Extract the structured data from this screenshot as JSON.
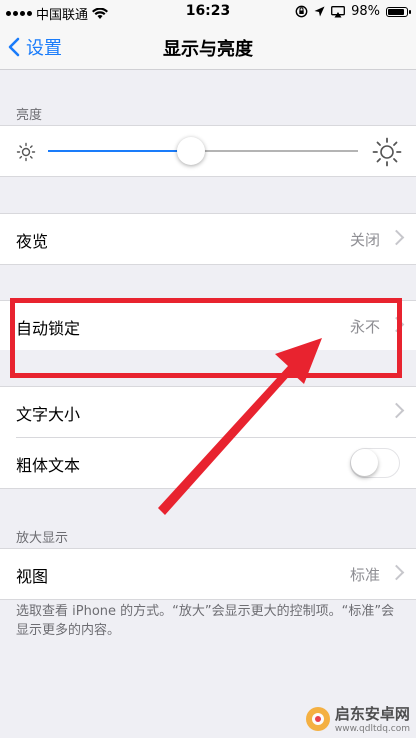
{
  "status_bar": {
    "carrier": "中国联通",
    "time": "16:23",
    "battery": "98%"
  },
  "nav": {
    "back_label": "设置",
    "title": "显示与亮度"
  },
  "brightness": {
    "header": "亮度",
    "level": 0.46
  },
  "night_shift": {
    "label": "夜览",
    "value": "关闭"
  },
  "auto_lock": {
    "label": "自动锁定",
    "value": "永不"
  },
  "text": {
    "text_size_label": "文字大小",
    "bold_text_label": "粗体文本",
    "bold_text_on": false
  },
  "zoom": {
    "header": "放大显示",
    "view_label": "视图",
    "view_value": "标准",
    "footer": "选取查看 iPhone 的方式。“放大”会显示更大的控制项。“标准”会显示更多的内容。"
  },
  "watermark": {
    "cn": "启东安卓网",
    "en": "www.qdltdq.com"
  },
  "colors": {
    "accent": "#1a7cfa",
    "highlight": "#e8232f"
  }
}
